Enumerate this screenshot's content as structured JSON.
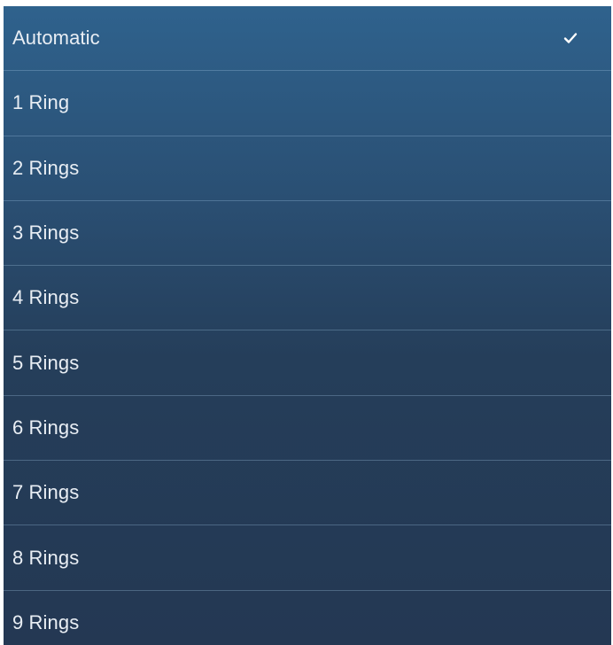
{
  "menu": {
    "items": [
      {
        "label": "Automatic",
        "selected": true
      },
      {
        "label": "1 Ring",
        "selected": false
      },
      {
        "label": "2 Rings",
        "selected": false
      },
      {
        "label": "3 Rings",
        "selected": false
      },
      {
        "label": "4 Rings",
        "selected": false
      },
      {
        "label": "5 Rings",
        "selected": false
      },
      {
        "label": "6 Rings",
        "selected": false
      },
      {
        "label": "7 Rings",
        "selected": false
      },
      {
        "label": "8 Rings",
        "selected": false
      },
      {
        "label": "9 Rings",
        "selected": false
      }
    ],
    "checkmark_icon": "checkmark-icon"
  }
}
